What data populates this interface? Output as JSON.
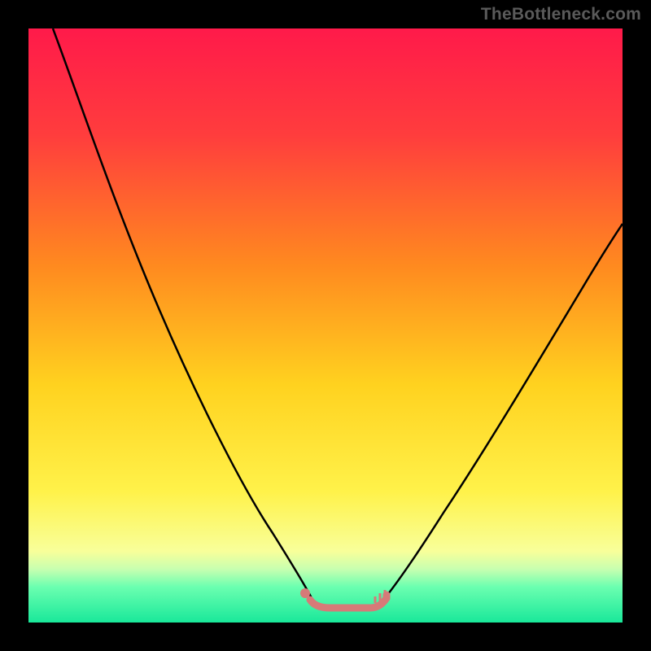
{
  "watermark": "TheBottleneck.com",
  "chart_data": {
    "type": "line",
    "title": "",
    "xlabel": "",
    "ylabel": "",
    "xlim": [
      0,
      100
    ],
    "ylim": [
      0,
      100
    ],
    "gradient_stops": [
      {
        "offset": 0,
        "color": "#ff1a4a"
      },
      {
        "offset": 18,
        "color": "#ff3d3d"
      },
      {
        "offset": 40,
        "color": "#ff8a1f"
      },
      {
        "offset": 60,
        "color": "#ffd21f"
      },
      {
        "offset": 78,
        "color": "#fff24a"
      },
      {
        "offset": 88,
        "color": "#f8ff9a"
      },
      {
        "offset": 91,
        "color": "#c8ffb0"
      },
      {
        "offset": 94,
        "color": "#6bffb0"
      },
      {
        "offset": 100,
        "color": "#19e89a"
      }
    ],
    "series": [
      {
        "name": "left-curve",
        "stroke": "#000000",
        "points": [
          {
            "x": 4,
            "y": 100
          },
          {
            "x": 8,
            "y": 90
          },
          {
            "x": 13,
            "y": 78
          },
          {
            "x": 19,
            "y": 64
          },
          {
            "x": 25,
            "y": 50
          },
          {
            "x": 31,
            "y": 36
          },
          {
            "x": 37,
            "y": 22
          },
          {
            "x": 42,
            "y": 11
          },
          {
            "x": 45,
            "y": 6
          },
          {
            "x": 47,
            "y": 4
          }
        ]
      },
      {
        "name": "right-curve",
        "stroke": "#000000",
        "points": [
          {
            "x": 60,
            "y": 4
          },
          {
            "x": 63,
            "y": 6
          },
          {
            "x": 67,
            "y": 12
          },
          {
            "x": 72,
            "y": 20
          },
          {
            "x": 78,
            "y": 30
          },
          {
            "x": 85,
            "y": 42
          },
          {
            "x": 92,
            "y": 54
          },
          {
            "x": 100,
            "y": 67
          }
        ]
      },
      {
        "name": "bottom-flat",
        "stroke": "#d67a78",
        "points": [
          {
            "x": 47,
            "y": 3.5
          },
          {
            "x": 50,
            "y": 2.8
          },
          {
            "x": 53,
            "y": 2.8
          },
          {
            "x": 56,
            "y": 2.9
          },
          {
            "x": 59,
            "y": 3.2
          },
          {
            "x": 60,
            "y": 4
          }
        ]
      }
    ],
    "marker": {
      "x": 46.5,
      "y": 5,
      "color": "#d67a78",
      "r": 5
    }
  }
}
